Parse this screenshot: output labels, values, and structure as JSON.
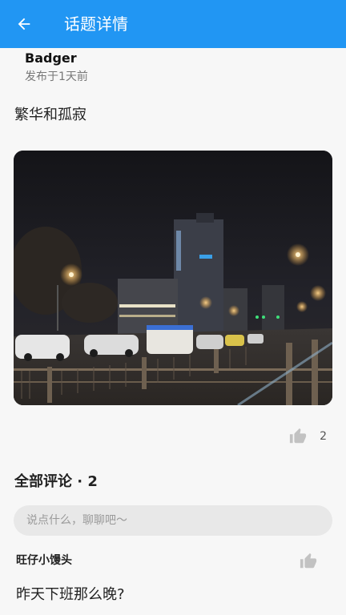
{
  "appbar": {
    "title": "话题详情"
  },
  "post": {
    "author": "Badger",
    "posted_time": "发布于1天前",
    "text": "繁华和孤寂",
    "like_count": "2"
  },
  "comments": {
    "header": "全部评论 · 2",
    "input_placeholder": "说点什么，聊聊吧～",
    "items": [
      {
        "user": "旺仔小馒头",
        "text": "昨天下班那么晚?"
      }
    ]
  },
  "icons": {
    "back": "arrow-back-icon",
    "like": "thumb-up-icon"
  },
  "colors": {
    "primary": "#2196f3",
    "background": "#f7f7f7",
    "input_bg": "#e8e8e8"
  }
}
